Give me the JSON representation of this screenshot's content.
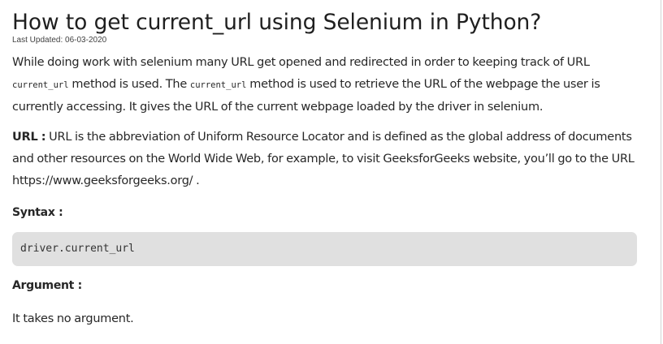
{
  "article": {
    "title": "How to get current_url using Selenium in Python?",
    "last_updated": "Last Updated: 06-03-2020",
    "intro": {
      "part1": "While doing work with selenium many URL get opened and redirected in order to keeping track of URL ",
      "code1": "current_url",
      "part2": " method is used. The ",
      "code2": "current_url",
      "part3": " method is used to retrieve the URL of the webpage the user is currently accessing. It gives the URL of the current webpage loaded by the driver in selenium."
    },
    "url_definition": {
      "term": "URL :",
      "text": " URL is the abbreviation of Uniform Resource Locator and is defined as the global address of documents and other resources on the World Wide Web, for example, to visit GeeksforGeeks website, you’ll go to the URL https://www.geeksforgeeks.org/ ."
    },
    "syntax_heading": "Syntax :",
    "syntax_code": "driver.current_url",
    "argument_heading": "Argument :",
    "argument_text": "It takes no argument."
  }
}
